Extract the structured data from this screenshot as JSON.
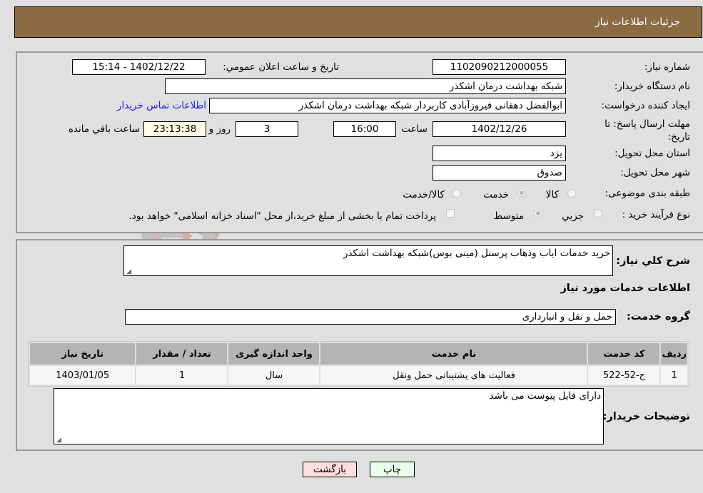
{
  "header": {
    "title": "جزئیات اطلاعات نیاز"
  },
  "details": {
    "need_number": {
      "label": "شماره نیاز:",
      "value": "1102090212000055"
    },
    "announce_datetime": {
      "label": "تاریخ و ساعت اعلان عمومي:",
      "value": "1402/12/22 - 15:14"
    },
    "buyer_org": {
      "label": "نام دستگاه خريدار:",
      "value": "شبکه بهداشت درمان اشکذر"
    },
    "requester": {
      "label": "ایجاد کننده درخواست:",
      "value": "ابوالفضل دهقانی فیروزآبادی کاربردار شبکه بهداشت درمان اشکذر"
    },
    "buyer_contact_link": "اطلاعات تماس خريدار",
    "deadline": {
      "label": "مهلت ارسال پاسخ: تا تاریخ:",
      "date": "1402/12/26",
      "time_label": "ساعت",
      "time": "16:00",
      "days": "3",
      "days_label": "روز و",
      "remaining": "23:13:38",
      "remaining_label": "ساعت باقي مانده"
    },
    "province": {
      "label": "استان محل تحویل:",
      "value": "یزد"
    },
    "city": {
      "label": "شهر محل تحویل:",
      "value": "صدوق"
    },
    "category": {
      "label": "طبقه بندی موضوعی:",
      "options": [
        "کالا",
        "خدمت",
        "کالا/خدمت"
      ],
      "selected": "خدمت"
    },
    "purchase_type": {
      "label": "نوع فرآیند خرید :",
      "options": [
        "جزيي",
        "متوسط"
      ],
      "selected": "متوسط",
      "treasury_note": "پرداخت تمام یا بخشی از مبلغ خرید،از محل \"اسناد خزانه اسلامی\" خواهد بود."
    }
  },
  "summary": {
    "label": "شرح کلي نياز:",
    "value": "خرید خدمات ایاب وذهاب پرسنل (مینی بوس)شبکه بهداشت اشکذر"
  },
  "services_section_title": "اطلاعات خدمات مورد نیاز",
  "service_group": {
    "label": "گروه خدمت:",
    "value": "حمل و نقل و انبارداری"
  },
  "services_table": {
    "headers": [
      "ردیف",
      "کد خدمت",
      "نام خدمت",
      "واحد اندازه گیری",
      "تعداد / مقدار",
      "تاریخ نیاز"
    ],
    "rows": [
      [
        "1",
        "ح-52-522",
        "فعالیت های پشتیبانی حمل ونقل",
        "سال",
        "1",
        "1403/01/05"
      ]
    ]
  },
  "buyer_notes": {
    "label": "توضیحات خریدار:",
    "value": "دارای فایل پیوست می باشد"
  },
  "buttons": {
    "print": "چاپ",
    "back": "بازگشت"
  },
  "colors": {
    "header_bg": "#8b6b42",
    "link": "#1a1aff",
    "print_bg": "#eaffea",
    "back_bg": "#ffdede"
  },
  "watermark": "AriaTender.neT"
}
